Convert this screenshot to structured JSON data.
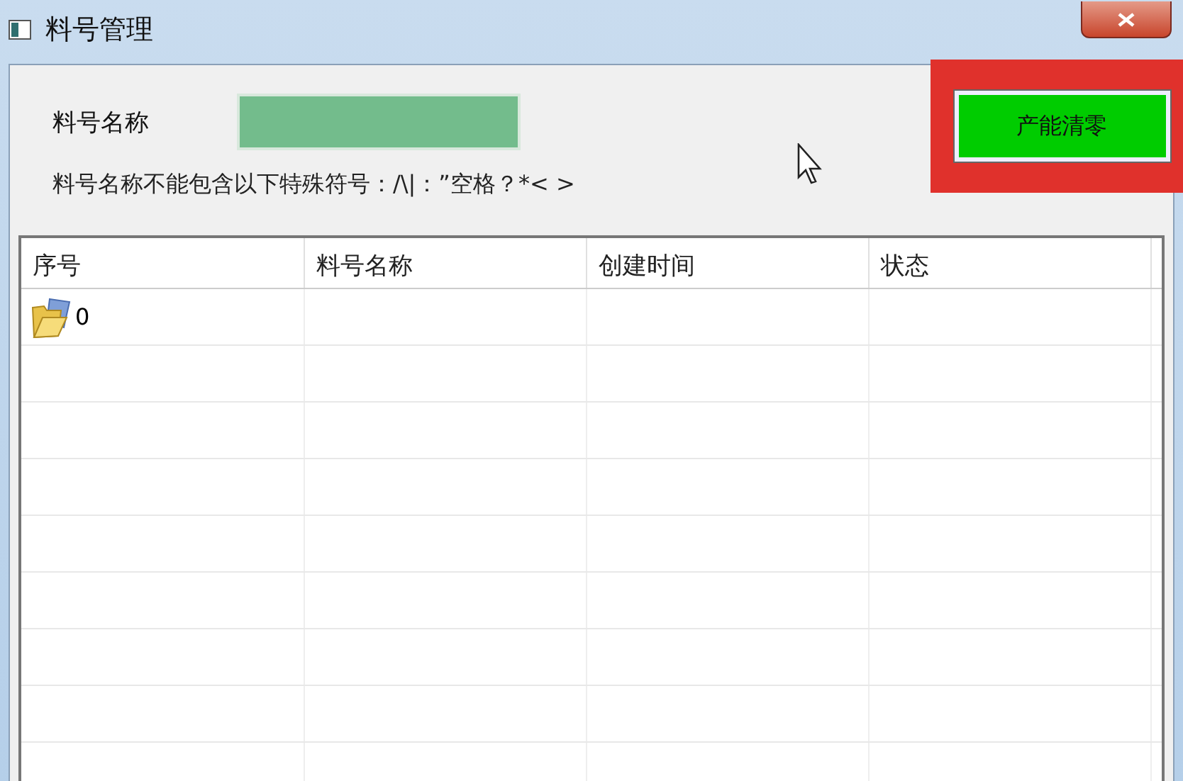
{
  "window": {
    "title": "料号管理"
  },
  "form": {
    "label": "料号名称",
    "hint": "料号名称不能包含以下特殊符号：/\\|：”空格？*< >"
  },
  "button": {
    "label": "产能清零",
    "highlighted": true
  },
  "table": {
    "columns": [
      "序号",
      "料号名称",
      "创建时间",
      "状态"
    ],
    "rows": [
      {
        "index": "0"
      }
    ]
  }
}
